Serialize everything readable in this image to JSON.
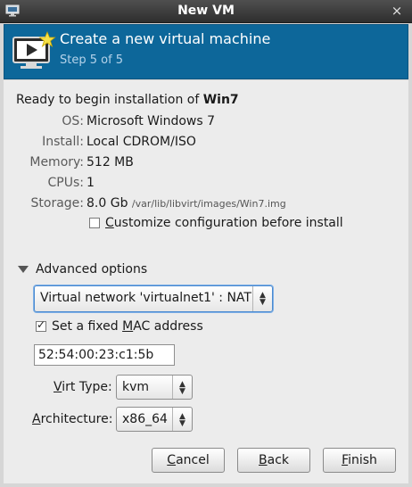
{
  "window": {
    "title": "New VM",
    "close_glyph": "×"
  },
  "header": {
    "title": "Create a new virtual machine",
    "step": "Step 5 of 5",
    "bg_color": "#0d679a"
  },
  "summary": {
    "ready_prefix": "Ready to begin installation of",
    "vm_name": "Win7",
    "os_label": "OS:",
    "os_value": "Microsoft Windows 7",
    "install_label": "Install:",
    "install_value": "Local CDROM/ISO",
    "memory_label": "Memory:",
    "memory_value": "512 MB",
    "cpus_label": "CPUs:",
    "cpus_value": "1",
    "storage_label": "Storage:",
    "storage_value": "8.0 Gb",
    "storage_path": "/var/lib/libvirt/images/Win7.img"
  },
  "customize": {
    "mnemonic": "C",
    "rest": "ustomize configuration before install",
    "checked": false
  },
  "advanced": {
    "label": "Advanced options",
    "network_value": "Virtual network 'virtualnet1' : NAT",
    "mac_checkbox_pre": "Set a fixed ",
    "mac_checkbox_mn": "M",
    "mac_checkbox_post": "AC address",
    "mac_checked": true,
    "mac_value": "52:54:00:23:c1:5b",
    "virt_type_mn": "V",
    "virt_type_rest": "irt Type:",
    "virt_type_value": "kvm",
    "arch_mn": "A",
    "arch_rest": "rchitecture:",
    "arch_value": "x86_64"
  },
  "buttons": {
    "cancel_mn": "C",
    "cancel_rest": "ancel",
    "back_mn": "B",
    "back_rest": "ack",
    "finish_mn": "F",
    "finish_rest": "inish"
  },
  "icons": {
    "window": "monitor-icon",
    "header": "vm-monitor-star-icon"
  }
}
